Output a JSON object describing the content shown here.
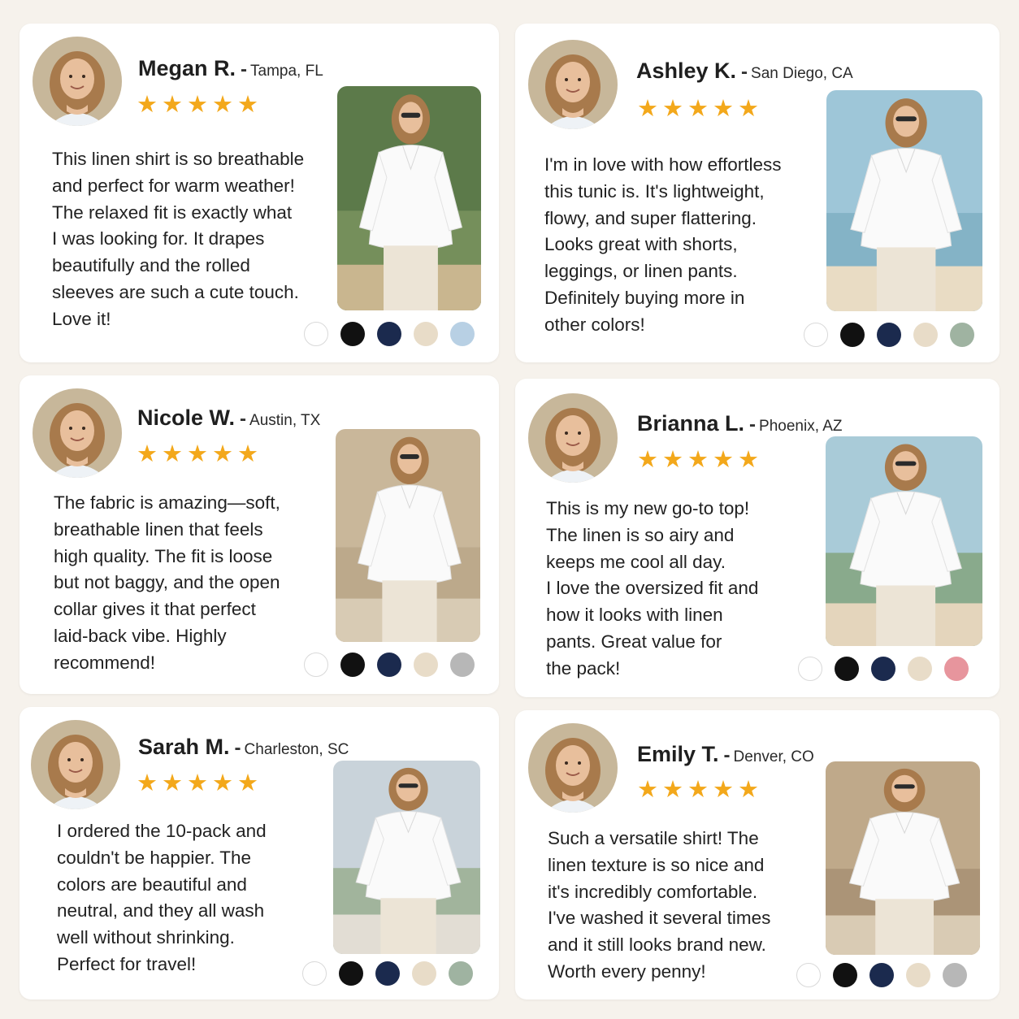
{
  "reviews": [
    {
      "name": "Megan R.",
      "location": "Tampa, FL",
      "rating": 5,
      "stars": "★★★★★",
      "text_lines": [
        "This linen shirt is so breathable",
        "and perfect for warm weather!",
        "The relaxed fit is exactly what",
        "I was looking for. It drapes",
        "beautifully and the rolled",
        "sleeves are such a cute touch.",
        "Love it!"
      ],
      "swatches": [
        "#ffffff",
        "#111111",
        "#1b2a4e",
        "#e8dcc8",
        "#b8d0e4"
      ]
    },
    {
      "name": "Ashley K.",
      "location": "San Diego, CA",
      "rating": 5,
      "stars": "★★★★★",
      "text_lines": [
        "I'm in love with how effortless",
        "this tunic is. It's lightweight,",
        "flowy, and super flattering.",
        "Looks great with shorts,",
        "leggings, or linen pants.",
        "Definitely buying more in",
        "other colors!"
      ],
      "swatches": [
        "#ffffff",
        "#111111",
        "#1b2a4e",
        "#e8dcc8",
        "#9fb3a1"
      ]
    },
    {
      "name": "Nicole W.",
      "location": "Austin, TX",
      "rating": 5,
      "stars": "★★★★★",
      "text_lines": [
        "The fabric is amazing—soft,",
        "breathable linen that feels",
        "high quality. The fit is loose",
        "but not baggy, and the open",
        "collar gives it that perfect",
        "laid-back vibe. Highly",
        "recommend!"
      ],
      "swatches": [
        "#ffffff",
        "#111111",
        "#1b2a4e",
        "#e8dcc8",
        "#b7b7b7"
      ]
    },
    {
      "name": "Brianna L.",
      "location": "Phoenix, AZ",
      "rating": 5,
      "stars": "★★★★★",
      "text_lines": [
        "This is my new go-to top!",
        "The linen is so airy and",
        "keeps me cool all day.",
        "I love the oversized fit and",
        "how it looks with linen",
        "pants. Great value for",
        "the pack!"
      ],
      "swatches": [
        "#ffffff",
        "#111111",
        "#1b2a4e",
        "#e8dcc8",
        "#e7959d"
      ]
    },
    {
      "name": "Sarah M.",
      "location": "Charleston, SC",
      "rating": 5,
      "stars": "★★★★★",
      "text_lines": [
        "I ordered the 10-pack and",
        "couldn't be happier. The",
        "colors are beautiful and",
        "neutral, and they all wash",
        "well without shrinking.",
        "Perfect for travel!"
      ],
      "swatches": [
        "#ffffff",
        "#111111",
        "#1b2a4e",
        "#e8dcc8",
        "#9fb3a1"
      ]
    },
    {
      "name": "Emily T.",
      "location": "Denver, CO",
      "rating": 5,
      "stars": "★★★★★",
      "text_lines": [
        "Such a versatile shirt! The",
        "linen texture is so nice and",
        "it's incredibly comfortable.",
        "I've washed it several times",
        "and it still looks brand new.",
        "Worth every penny!"
      ],
      "swatches": [
        "#ffffff",
        "#111111",
        "#1b2a4e",
        "#e8dcc8",
        "#b7b7b7"
      ]
    }
  ],
  "name_separator": "-",
  "colors": {
    "page_background": "#f6f2ec",
    "card_background": "#ffffff",
    "star": "#f3a81b",
    "shirt": "#fafafa",
    "hair": "#a87a4c",
    "skin": "#e8bf9c"
  },
  "icons": {
    "star": "star-icon",
    "avatar": "reviewer-avatar",
    "photo": "product-photo"
  }
}
